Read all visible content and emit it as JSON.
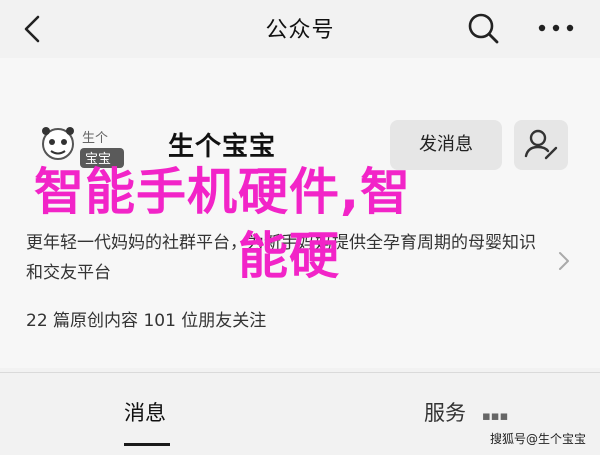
{
  "header": {
    "title": "公众号",
    "icons": {
      "back": "chevron-left-icon",
      "search": "search-icon",
      "more": "more-dots-icon"
    }
  },
  "account": {
    "logo_text": [
      "生个",
      "宝宝"
    ],
    "name": "生个宝宝",
    "message_button": "发消息",
    "user_button_icon": "user-settings-icon",
    "description": "更年轻一代妈妈的社群平台，为新手妈妈提供全孕育周期的母婴知识和交友平台",
    "stats": "22 篇原创内容  101 位朋友关注"
  },
  "overlay": {
    "line1": "智能手机硬件,智",
    "line2": "能硬",
    "color": "#f224c8"
  },
  "tabs": {
    "news": "消息",
    "service": "服务",
    "service_icon": "dots-icon"
  },
  "watermark": "搜狐号@生个宝宝"
}
